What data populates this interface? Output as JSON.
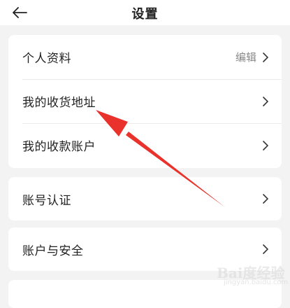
{
  "header": {
    "title": "设置",
    "back_icon": "arrow-left-icon"
  },
  "groups": [
    {
      "items": [
        {
          "label": "个人资料",
          "hint": "编辑",
          "icon": "chevron-right-icon"
        },
        {
          "label": "我的收货地址",
          "hint": "",
          "icon": "chevron-right-icon"
        },
        {
          "label": "我的收款账户",
          "hint": "",
          "icon": "chevron-right-icon"
        }
      ]
    },
    {
      "items": [
        {
          "label": "账号认证",
          "hint": "",
          "icon": "chevron-right-icon"
        }
      ]
    },
    {
      "items": [
        {
          "label": "账户与安全",
          "hint": "",
          "icon": "chevron-right-icon"
        }
      ]
    }
  ],
  "annotation": {
    "arrow_color": "#e8322b",
    "points_to": "我的收货地址"
  },
  "watermark": {
    "text": "Bai度经验",
    "sub": "jingyan.baidu.com"
  },
  "colors": {
    "background": "#f3f3f3",
    "card": "#ffffff",
    "text": "#222222",
    "hint": "#888888"
  }
}
